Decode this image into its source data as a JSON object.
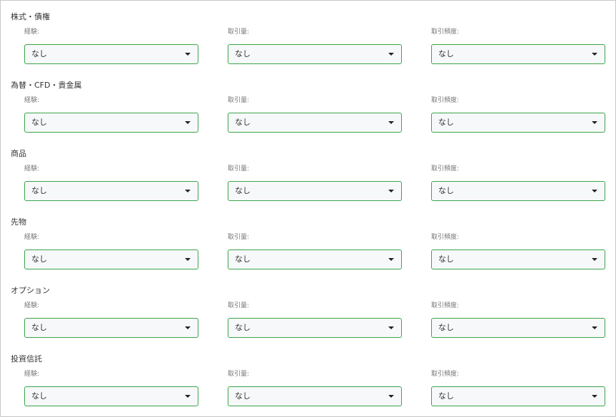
{
  "field_labels": {
    "experience": "経験:",
    "volume": "取引量:",
    "frequency": "取引頻度:"
  },
  "sections": [
    {
      "title": "株式・債権",
      "experience": "なし",
      "volume": "なし",
      "frequency": "なし"
    },
    {
      "title": "為替・CFD・貴金属",
      "experience": "なし",
      "volume": "なし",
      "frequency": "なし"
    },
    {
      "title": "商品",
      "experience": "なし",
      "volume": "なし",
      "frequency": "なし"
    },
    {
      "title": "先物",
      "experience": "なし",
      "volume": "なし",
      "frequency": "なし"
    },
    {
      "title": "オプション",
      "experience": "なし",
      "volume": "なし",
      "frequency": "なし"
    },
    {
      "title": "投資信託",
      "experience": "なし",
      "volume": "なし",
      "frequency": "なし"
    }
  ],
  "colors": {
    "select_border": "#3aa54a",
    "select_bg": "#f7f8f9",
    "label": "#777777"
  }
}
